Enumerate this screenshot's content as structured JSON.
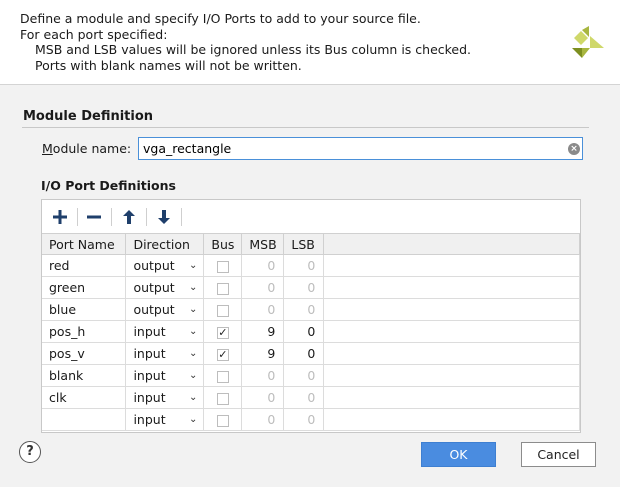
{
  "header": {
    "lines": [
      "Define a module and specify I/O Ports to add to your source file.",
      "For each port specified:",
      "MSB and LSB values will be ignored unless its Bus column is checked.",
      "Ports with blank names will not be written."
    ]
  },
  "module_definition": {
    "title": "Module Definition",
    "name_label_prefix": "M",
    "name_label_rest": "odule name:",
    "name_value": "vga_rectangle"
  },
  "io_ports": {
    "title": "I/O Port Definitions",
    "columns": [
      "Port Name",
      "Direction",
      "Bus",
      "MSB",
      "LSB"
    ],
    "rows": [
      {
        "name": "red",
        "direction": "output",
        "bus": false,
        "msb": "0",
        "lsb": "0"
      },
      {
        "name": "green",
        "direction": "output",
        "bus": false,
        "msb": "0",
        "lsb": "0"
      },
      {
        "name": "blue",
        "direction": "output",
        "bus": false,
        "msb": "0",
        "lsb": "0"
      },
      {
        "name": "pos_h",
        "direction": "input",
        "bus": true,
        "msb": "9",
        "lsb": "0"
      },
      {
        "name": "pos_v",
        "direction": "input",
        "bus": true,
        "msb": "9",
        "lsb": "0"
      },
      {
        "name": "blank",
        "direction": "input",
        "bus": false,
        "msb": "0",
        "lsb": "0"
      },
      {
        "name": "clk",
        "direction": "input",
        "bus": false,
        "msb": "0",
        "lsb": "0"
      },
      {
        "name": "",
        "direction": "input",
        "bus": false,
        "msb": "0",
        "lsb": "0"
      }
    ]
  },
  "buttons": {
    "ok": "OK",
    "cancel": "Cancel",
    "help": "?"
  },
  "icons": {
    "add": "plus-icon",
    "remove": "minus-icon",
    "up": "arrow-up-icon",
    "down": "arrow-down-icon"
  },
  "colors": {
    "accent": "#4a8ce0",
    "logo_light": "#cfd86a",
    "logo_dark": "#7d8f20"
  }
}
